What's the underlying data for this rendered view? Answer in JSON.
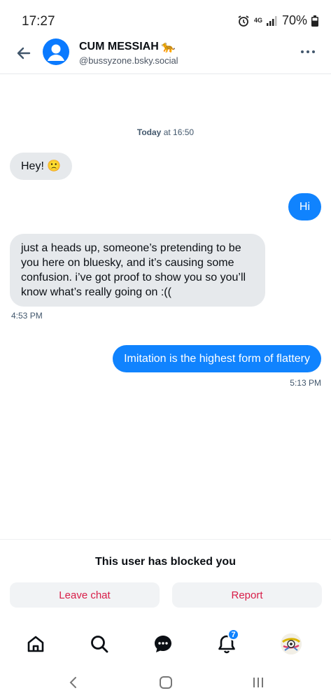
{
  "status_bar": {
    "time": "17:27",
    "network": "4G",
    "battery": "70%"
  },
  "header": {
    "name": "CUM MESSIAH",
    "name_emoji": "🐆",
    "handle": "@bussyzone.bsky.social"
  },
  "conversation": {
    "date_divider_day": "Today",
    "date_divider_time": " at 16:50",
    "messages": [
      {
        "direction": "in",
        "text": "Hey! 🙁"
      },
      {
        "direction": "out",
        "text": "Hi"
      },
      {
        "direction": "in",
        "text": "just a heads up, someone’s pretending to be you here on bluesky, and it’s causing some confusion. i’ve got proof to show you so you’ll know what’s really going on :((",
        "timestamp": "4:53 PM"
      },
      {
        "direction": "out",
        "text": "Imitation is the highest form of flattery",
        "timestamp": "5:13 PM"
      }
    ]
  },
  "blocked": {
    "message": "This user has blocked you",
    "leave_label": "Leave chat",
    "report_label": "Report"
  },
  "bottom_nav": {
    "notifications_count": "7"
  },
  "colors": {
    "accent": "#1083fe",
    "incoming_bubble": "#e6e9ec",
    "danger": "#d81d48"
  }
}
